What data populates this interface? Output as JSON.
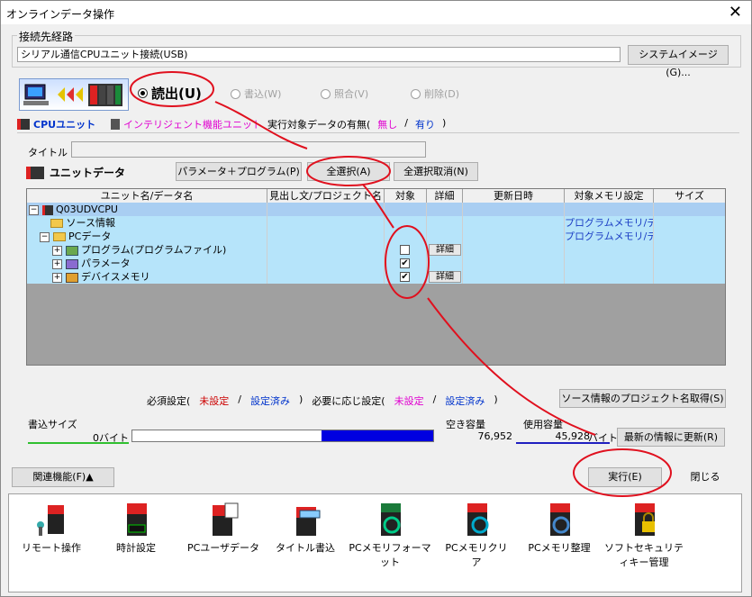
{
  "window": {
    "title": "オンラインデータ操作",
    "close": "✕"
  },
  "connection": {
    "group_label": "接続先経路",
    "value": "シリアル通信CPUユニット接続(USB)",
    "system_image_button": "システムイメージ(G)..."
  },
  "operations": [
    {
      "label": "読出(U)",
      "selected": true
    },
    {
      "label": "書込(W)",
      "selected": false
    },
    {
      "label": "照合(V)",
      "selected": false
    },
    {
      "label": "削除(D)",
      "selected": false
    }
  ],
  "tabs": {
    "cpu_unit": "CPUユニット",
    "intelligent": "インテリジェント機能ユニット"
  },
  "target_presence": {
    "label": "実行対象データの有無(",
    "none": "無し",
    "slash": "/",
    "present": "有り",
    "close": ")"
  },
  "title_field": {
    "label": "タイトル",
    "value": ""
  },
  "unit_data": {
    "label": "ユニットデータ",
    "param_program_button": "パラメータ＋プログラム(P)",
    "select_all_button": "全選択(A)",
    "deselect_all_button": "全選択取消(N)"
  },
  "grid": {
    "headers": [
      "ユニット名/データ名",
      "見出し文/プロジェクト名",
      "対象",
      "詳細",
      "更新日時",
      "対象メモリ設定",
      "サイズ"
    ],
    "rows": [
      {
        "expander": "−",
        "name": "Q03UDVCPU",
        "indent": 0,
        "checked": null,
        "detail": "",
        "memory": ""
      },
      {
        "expander": "",
        "name": "ソース情報",
        "indent": 1,
        "checked": null,
        "detail": "",
        "memory": "プログラムメモリ/デ..."
      },
      {
        "expander": "−",
        "name": "PCデータ",
        "indent": 1,
        "checked": null,
        "detail": "",
        "memory": "プログラムメモリ/デ..."
      },
      {
        "expander": "+",
        "name": "プログラム(プログラムファイル)",
        "indent": 2,
        "checked": false,
        "detail": "詳細",
        "memory": ""
      },
      {
        "expander": "+",
        "name": "パラメータ",
        "indent": 2,
        "checked": true,
        "detail": "",
        "memory": ""
      },
      {
        "expander": "+",
        "name": "デバイスメモリ",
        "indent": 2,
        "checked": true,
        "detail": "詳細",
        "memory": ""
      }
    ]
  },
  "settings_legend": {
    "required_label": "必須設定(",
    "not_set": "未設定",
    "slash": "/",
    "set": "設定済み",
    "close": ")",
    "optional_label": "必要に応じ設定(",
    "opt_not_set": "未設定",
    "opt_set": "設定済み",
    "opt_close": ")",
    "get_project_name_button": "ソース情報のプロジェクト名取得(S)"
  },
  "capacity": {
    "write_size_label": "書込サイズ",
    "write_size_value": "0バイト",
    "free_label": "空き容量",
    "free_value": "76,952",
    "used_label": "使用容量",
    "used_value": "45,928",
    "used_unit": "バイト",
    "usage_fraction": 0.37,
    "refresh_button": "最新の情報に更新(R)"
  },
  "footer": {
    "related_button": "関連機能(F)▲",
    "execute_button": "実行(E)",
    "close_button": "閉じる"
  },
  "tools": [
    {
      "label": "リモート操作",
      "icon": "remote-operation-icon"
    },
    {
      "label": "時計設定",
      "icon": "clock-setting-icon",
      "display": "8:00"
    },
    {
      "label": "PCユーザデータ",
      "icon": "pc-user-data-icon"
    },
    {
      "label": "タイトル書込",
      "icon": "title-write-icon"
    },
    {
      "label": "PCメモリフォーマット",
      "icon": "pc-memory-format-icon"
    },
    {
      "label": "PCメモリクリア",
      "icon": "pc-memory-clear-icon"
    },
    {
      "label": "PCメモリ整理",
      "icon": "pc-memory-arrange-icon"
    },
    {
      "label": "ソフトセキュリティキー管理",
      "icon": "soft-security-key-icon"
    }
  ],
  "colors": {
    "annotation": "#e0101e",
    "row_bg": "#b6e4fa",
    "selected_row": "#a9cef2",
    "free_bar": "#0000e0",
    "write_line": "#30c030",
    "used_line": "#2020c0"
  }
}
